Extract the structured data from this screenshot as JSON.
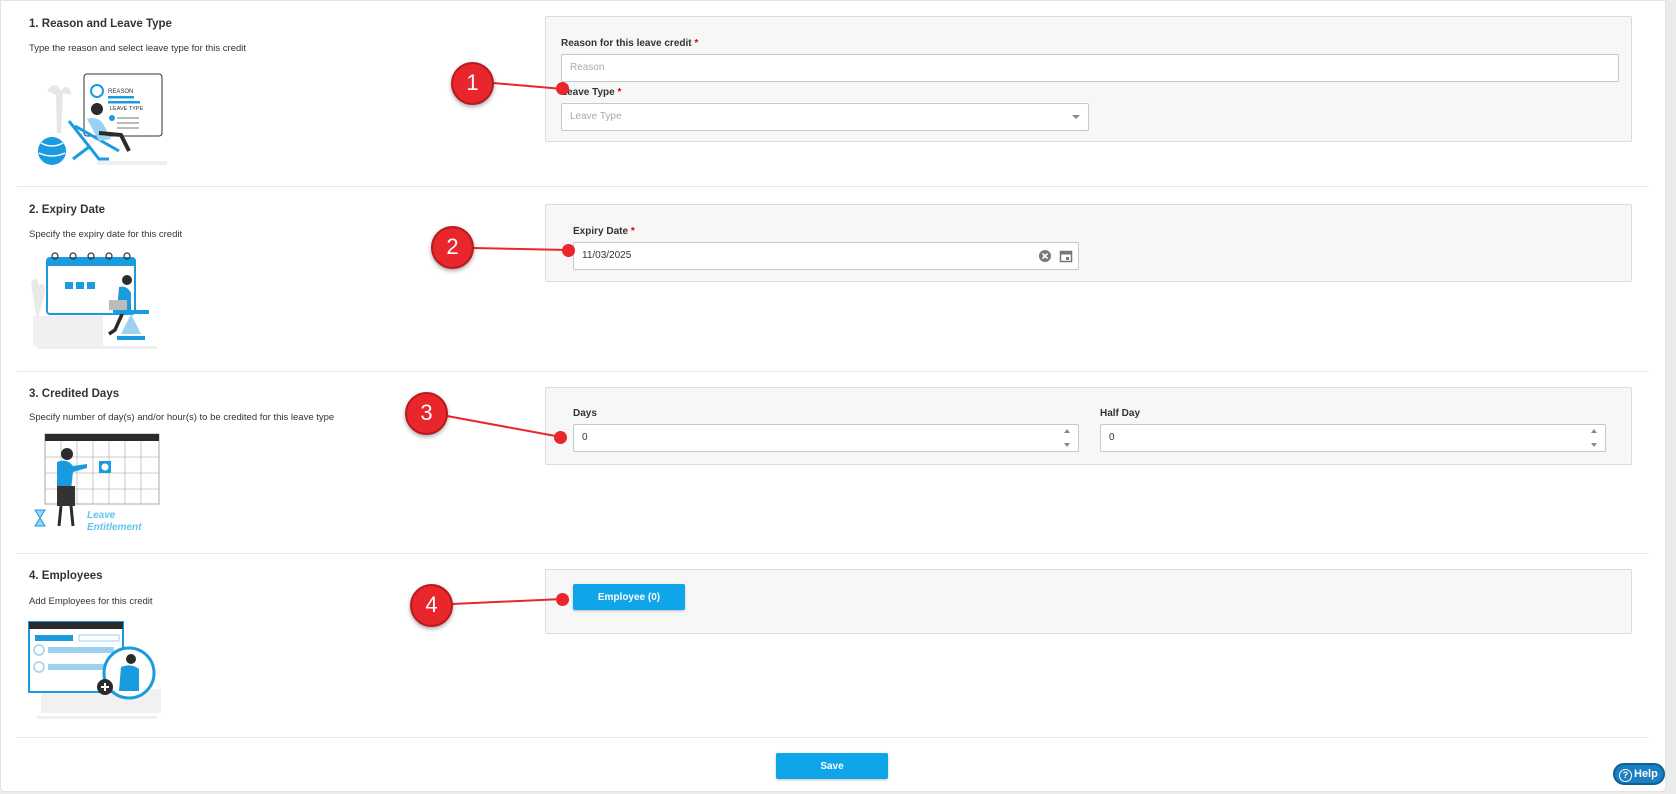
{
  "sections": {
    "reason": {
      "title": "1. Reason and Leave Type",
      "desc": "Type the reason and select leave type for this credit",
      "reason_label": "Reason for this leave credit",
      "reason_placeholder": "Reason",
      "leave_type_label": "Leave Type",
      "leave_type_placeholder": "Leave Type",
      "illus_reason": "REASON",
      "illus_leave_type": "LEAVE TYPE"
    },
    "expiry": {
      "title": "2. Expiry Date",
      "desc": "Specify the expiry date for this credit",
      "expiry_label": "Expiry Date",
      "expiry_value": "11/03/2025"
    },
    "credited": {
      "title": "3. Credited Days",
      "desc": "Specify number of day(s) and/or hour(s) to be credited for this leave type",
      "days_label": "Days",
      "days_value": "0",
      "halfday_label": "Half Day",
      "halfday_value": "0",
      "illus_leave": "Leave",
      "illus_entitlement": "Entitlement"
    },
    "employees": {
      "title": "4. Employees",
      "desc": "Add Employees for this credit",
      "employee_button": "Employee (0)"
    }
  },
  "required_mark": "*",
  "save_label": "Save",
  "help_label": "Help",
  "help_icon_glyph": "?",
  "callouts": [
    "1",
    "2",
    "3",
    "4"
  ],
  "colors": {
    "accent": "#0ea5e9",
    "callout": "#e8262b",
    "help": "#1a7fc1"
  }
}
